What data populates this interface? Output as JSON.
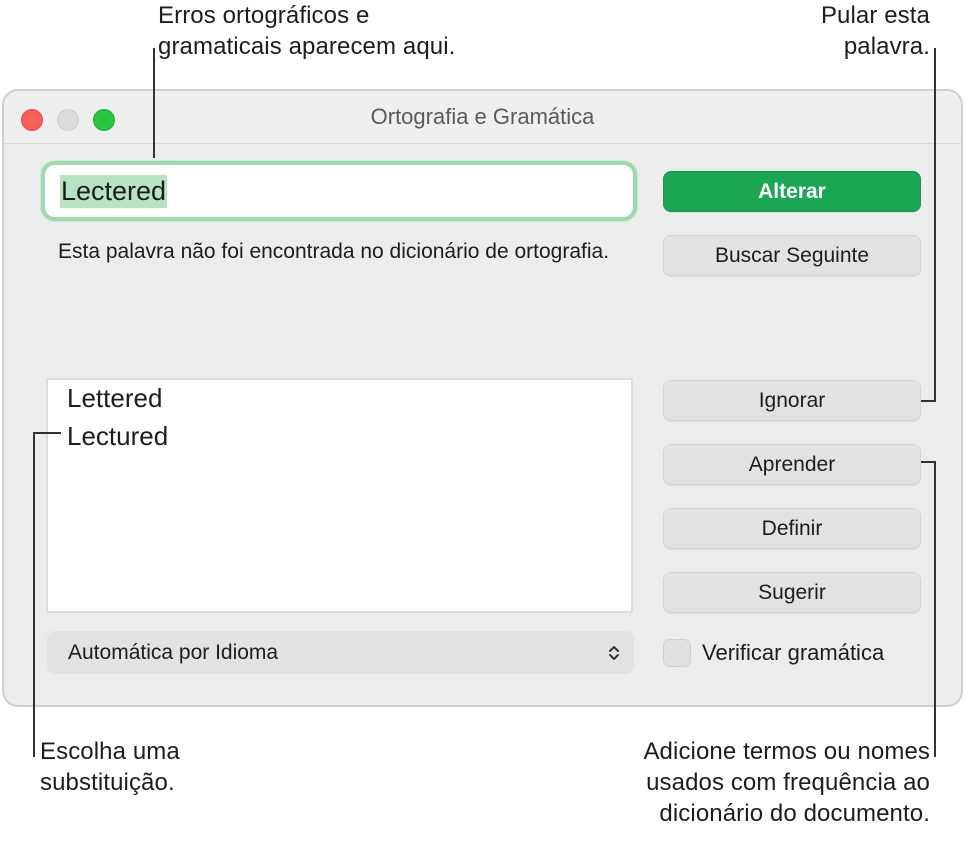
{
  "callouts": {
    "errors": [
      "Erros ortográficos e",
      "gramaticais aparecem aqui."
    ],
    "skip": [
      "Pular esta",
      "palavra."
    ],
    "choose": [
      "Escolha uma",
      "substituição."
    ],
    "add": [
      "Adicione termos ou nomes",
      "usados com frequência ao",
      "dicionário do documento."
    ]
  },
  "window": {
    "title": "Ortografia e Gramática",
    "misspelled_word": "Lectered",
    "message": "Esta palavra não foi encontrada no dicionário de ortografia.",
    "guesses": [
      "Lettered",
      "Lectured"
    ],
    "language": "Automática por Idioma",
    "buttons": {
      "change": "Alterar",
      "find_next": "Buscar Seguinte",
      "ignore": "Ignorar",
      "learn": "Aprender",
      "define": "Definir",
      "guess": "Sugerir"
    },
    "check_grammar": {
      "label": "Verificar gramática",
      "checked": false
    }
  },
  "colors": {
    "primary_button": "#1aa652",
    "focus_ring": "#9fd9b0",
    "selection": "#b8e3c3",
    "close": "#fe5f57",
    "zoom": "#28c840"
  }
}
